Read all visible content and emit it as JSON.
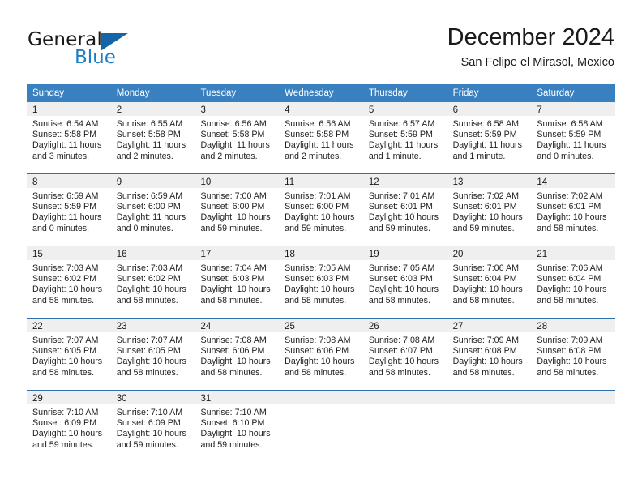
{
  "logo": {
    "word_top": "General",
    "word_bottom": "Blue",
    "triangle_color": "#1565a8",
    "blue_color": "#1f7fc4"
  },
  "header": {
    "title": "December 2024",
    "subtitle": "San Felipe el Mirasol, Mexico"
  },
  "colors": {
    "header_blue": "#3880c0",
    "row_divider_blue": "#2f6fae",
    "day_band_gray": "#efefef"
  },
  "calendar": {
    "weekday_headers": [
      "Sunday",
      "Monday",
      "Tuesday",
      "Wednesday",
      "Thursday",
      "Friday",
      "Saturday"
    ],
    "weeks": [
      [
        {
          "day": "1",
          "sunrise": "Sunrise: 6:54 AM",
          "sunset": "Sunset: 5:58 PM",
          "daylight_line1": "Daylight: 11 hours",
          "daylight_line2": "and 3 minutes."
        },
        {
          "day": "2",
          "sunrise": "Sunrise: 6:55 AM",
          "sunset": "Sunset: 5:58 PM",
          "daylight_line1": "Daylight: 11 hours",
          "daylight_line2": "and 2 minutes."
        },
        {
          "day": "3",
          "sunrise": "Sunrise: 6:56 AM",
          "sunset": "Sunset: 5:58 PM",
          "daylight_line1": "Daylight: 11 hours",
          "daylight_line2": "and 2 minutes."
        },
        {
          "day": "4",
          "sunrise": "Sunrise: 6:56 AM",
          "sunset": "Sunset: 5:58 PM",
          "daylight_line1": "Daylight: 11 hours",
          "daylight_line2": "and 2 minutes."
        },
        {
          "day": "5",
          "sunrise": "Sunrise: 6:57 AM",
          "sunset": "Sunset: 5:59 PM",
          "daylight_line1": "Daylight: 11 hours",
          "daylight_line2": "and 1 minute."
        },
        {
          "day": "6",
          "sunrise": "Sunrise: 6:58 AM",
          "sunset": "Sunset: 5:59 PM",
          "daylight_line1": "Daylight: 11 hours",
          "daylight_line2": "and 1 minute."
        },
        {
          "day": "7",
          "sunrise": "Sunrise: 6:58 AM",
          "sunset": "Sunset: 5:59 PM",
          "daylight_line1": "Daylight: 11 hours",
          "daylight_line2": "and 0 minutes."
        }
      ],
      [
        {
          "day": "8",
          "sunrise": "Sunrise: 6:59 AM",
          "sunset": "Sunset: 5:59 PM",
          "daylight_line1": "Daylight: 11 hours",
          "daylight_line2": "and 0 minutes."
        },
        {
          "day": "9",
          "sunrise": "Sunrise: 6:59 AM",
          "sunset": "Sunset: 6:00 PM",
          "daylight_line1": "Daylight: 11 hours",
          "daylight_line2": "and 0 minutes."
        },
        {
          "day": "10",
          "sunrise": "Sunrise: 7:00 AM",
          "sunset": "Sunset: 6:00 PM",
          "daylight_line1": "Daylight: 10 hours",
          "daylight_line2": "and 59 minutes."
        },
        {
          "day": "11",
          "sunrise": "Sunrise: 7:01 AM",
          "sunset": "Sunset: 6:00 PM",
          "daylight_line1": "Daylight: 10 hours",
          "daylight_line2": "and 59 minutes."
        },
        {
          "day": "12",
          "sunrise": "Sunrise: 7:01 AM",
          "sunset": "Sunset: 6:01 PM",
          "daylight_line1": "Daylight: 10 hours",
          "daylight_line2": "and 59 minutes."
        },
        {
          "day": "13",
          "sunrise": "Sunrise: 7:02 AM",
          "sunset": "Sunset: 6:01 PM",
          "daylight_line1": "Daylight: 10 hours",
          "daylight_line2": "and 59 minutes."
        },
        {
          "day": "14",
          "sunrise": "Sunrise: 7:02 AM",
          "sunset": "Sunset: 6:01 PM",
          "daylight_line1": "Daylight: 10 hours",
          "daylight_line2": "and 58 minutes."
        }
      ],
      [
        {
          "day": "15",
          "sunrise": "Sunrise: 7:03 AM",
          "sunset": "Sunset: 6:02 PM",
          "daylight_line1": "Daylight: 10 hours",
          "daylight_line2": "and 58 minutes."
        },
        {
          "day": "16",
          "sunrise": "Sunrise: 7:03 AM",
          "sunset": "Sunset: 6:02 PM",
          "daylight_line1": "Daylight: 10 hours",
          "daylight_line2": "and 58 minutes."
        },
        {
          "day": "17",
          "sunrise": "Sunrise: 7:04 AM",
          "sunset": "Sunset: 6:03 PM",
          "daylight_line1": "Daylight: 10 hours",
          "daylight_line2": "and 58 minutes."
        },
        {
          "day": "18",
          "sunrise": "Sunrise: 7:05 AM",
          "sunset": "Sunset: 6:03 PM",
          "daylight_line1": "Daylight: 10 hours",
          "daylight_line2": "and 58 minutes."
        },
        {
          "day": "19",
          "sunrise": "Sunrise: 7:05 AM",
          "sunset": "Sunset: 6:03 PM",
          "daylight_line1": "Daylight: 10 hours",
          "daylight_line2": "and 58 minutes."
        },
        {
          "day": "20",
          "sunrise": "Sunrise: 7:06 AM",
          "sunset": "Sunset: 6:04 PM",
          "daylight_line1": "Daylight: 10 hours",
          "daylight_line2": "and 58 minutes."
        },
        {
          "day": "21",
          "sunrise": "Sunrise: 7:06 AM",
          "sunset": "Sunset: 6:04 PM",
          "daylight_line1": "Daylight: 10 hours",
          "daylight_line2": "and 58 minutes."
        }
      ],
      [
        {
          "day": "22",
          "sunrise": "Sunrise: 7:07 AM",
          "sunset": "Sunset: 6:05 PM",
          "daylight_line1": "Daylight: 10 hours",
          "daylight_line2": "and 58 minutes."
        },
        {
          "day": "23",
          "sunrise": "Sunrise: 7:07 AM",
          "sunset": "Sunset: 6:05 PM",
          "daylight_line1": "Daylight: 10 hours",
          "daylight_line2": "and 58 minutes."
        },
        {
          "day": "24",
          "sunrise": "Sunrise: 7:08 AM",
          "sunset": "Sunset: 6:06 PM",
          "daylight_line1": "Daylight: 10 hours",
          "daylight_line2": "and 58 minutes."
        },
        {
          "day": "25",
          "sunrise": "Sunrise: 7:08 AM",
          "sunset": "Sunset: 6:06 PM",
          "daylight_line1": "Daylight: 10 hours",
          "daylight_line2": "and 58 minutes."
        },
        {
          "day": "26",
          "sunrise": "Sunrise: 7:08 AM",
          "sunset": "Sunset: 6:07 PM",
          "daylight_line1": "Daylight: 10 hours",
          "daylight_line2": "and 58 minutes."
        },
        {
          "day": "27",
          "sunrise": "Sunrise: 7:09 AM",
          "sunset": "Sunset: 6:08 PM",
          "daylight_line1": "Daylight: 10 hours",
          "daylight_line2": "and 58 minutes."
        },
        {
          "day": "28",
          "sunrise": "Sunrise: 7:09 AM",
          "sunset": "Sunset: 6:08 PM",
          "daylight_line1": "Daylight: 10 hours",
          "daylight_line2": "and 58 minutes."
        }
      ],
      [
        {
          "day": "29",
          "sunrise": "Sunrise: 7:10 AM",
          "sunset": "Sunset: 6:09 PM",
          "daylight_line1": "Daylight: 10 hours",
          "daylight_line2": "and 59 minutes."
        },
        {
          "day": "30",
          "sunrise": "Sunrise: 7:10 AM",
          "sunset": "Sunset: 6:09 PM",
          "daylight_line1": "Daylight: 10 hours",
          "daylight_line2": "and 59 minutes."
        },
        {
          "day": "31",
          "sunrise": "Sunrise: 7:10 AM",
          "sunset": "Sunset: 6:10 PM",
          "daylight_line1": "Daylight: 10 hours",
          "daylight_line2": "and 59 minutes."
        },
        {
          "day": "",
          "sunrise": "",
          "sunset": "",
          "daylight_line1": "",
          "daylight_line2": ""
        },
        {
          "day": "",
          "sunrise": "",
          "sunset": "",
          "daylight_line1": "",
          "daylight_line2": ""
        },
        {
          "day": "",
          "sunrise": "",
          "sunset": "",
          "daylight_line1": "",
          "daylight_line2": ""
        },
        {
          "day": "",
          "sunrise": "",
          "sunset": "",
          "daylight_line1": "",
          "daylight_line2": ""
        }
      ]
    ]
  }
}
